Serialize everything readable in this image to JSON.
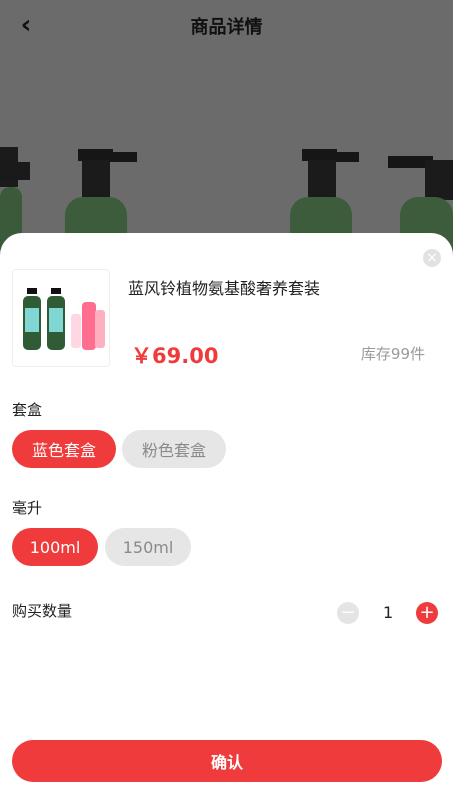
{
  "header": {
    "title": "商品详情",
    "back_icon": "chevron-left-icon"
  },
  "product": {
    "name": "蓝风铃植物氨基酸奢养套装",
    "price": "￥69.00",
    "stock": "库存99件"
  },
  "options": {
    "box": {
      "label": "套盒",
      "choices": [
        "蓝色套盒",
        "粉色套盒"
      ],
      "selected": "蓝色套盒"
    },
    "volume": {
      "label": "毫升",
      "choices": [
        "100ml",
        "150ml"
      ],
      "selected": "100ml"
    }
  },
  "quantity": {
    "label": "购买数量",
    "value": "1"
  },
  "actions": {
    "confirm": "确认"
  },
  "colors": {
    "accent": "#ef3b3b",
    "overlay": "#6b6b6b"
  }
}
